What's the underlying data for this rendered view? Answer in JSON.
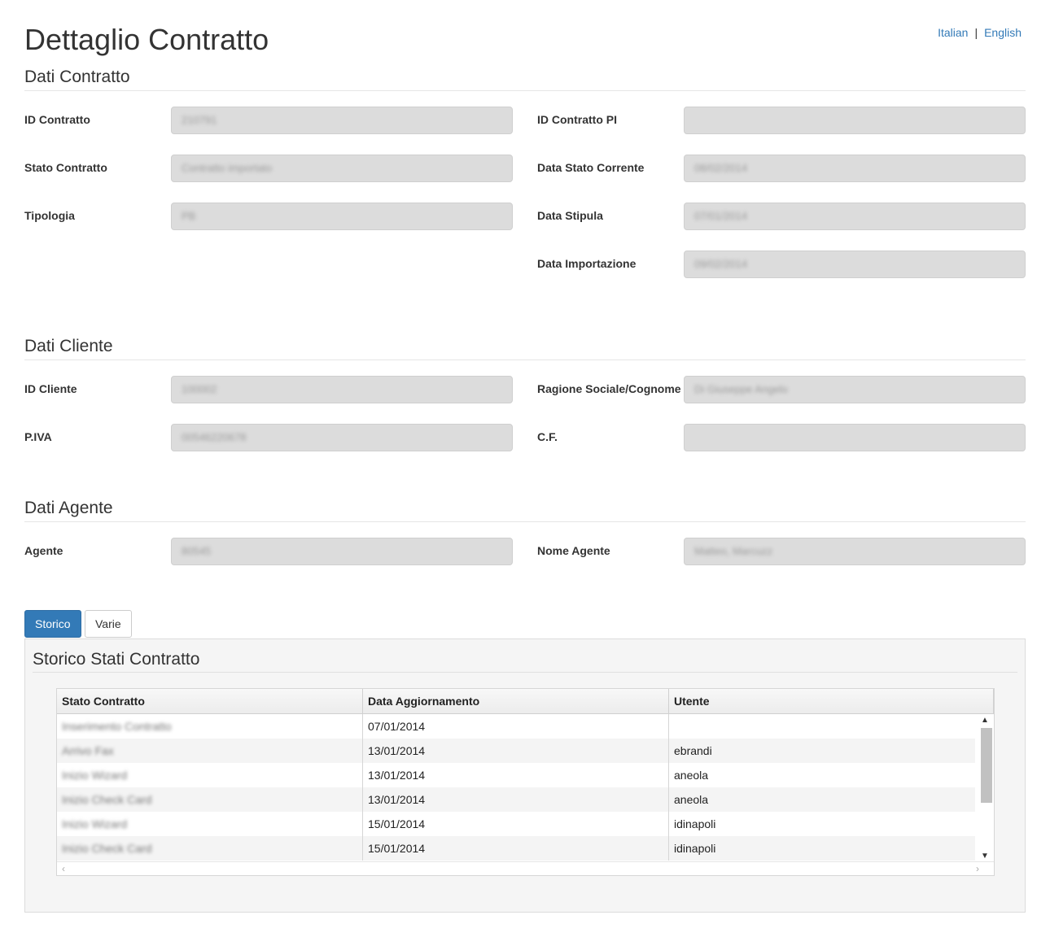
{
  "lang": {
    "italian": "Italian",
    "sep": "|",
    "english": "English"
  },
  "page_title": "Dettaglio Contratto",
  "sections": {
    "contratto": "Dati Contratto",
    "cliente": "Dati Cliente",
    "agente": "Dati Agente"
  },
  "contratto": {
    "id_contratto": {
      "label": "ID Contratto",
      "value": "210791"
    },
    "id_contratto_pi": {
      "label": "ID Contratto PI",
      "value": ""
    },
    "stato_contratto": {
      "label": "Stato Contratto",
      "value": "Contratto importato"
    },
    "data_stato_corrente": {
      "label": "Data Stato Corrente",
      "value": "08/02/2014"
    },
    "tipologia": {
      "label": "Tipologia",
      "value": "PB"
    },
    "data_stipula": {
      "label": "Data Stipula",
      "value": "07/01/2014"
    },
    "data_importazione": {
      "label": "Data Importazione",
      "value": "09/02/2014"
    }
  },
  "cliente": {
    "id_cliente": {
      "label": "ID Cliente",
      "value": "100002"
    },
    "ragione_sociale": {
      "label": "Ragione Sociale/Cognome",
      "value": "Di Giuseppe Angelo"
    },
    "piva": {
      "label": "P.IVA",
      "value": "00546220678"
    },
    "cf": {
      "label": "C.F.",
      "value": ""
    }
  },
  "agente": {
    "agente": {
      "label": "Agente",
      "value": "80545"
    },
    "nome_agente": {
      "label": "Nome Agente",
      "value": "Matteo, Marcuzz"
    }
  },
  "tabs": [
    {
      "label": "Storico",
      "active": true
    },
    {
      "label": "Varie",
      "active": false
    }
  ],
  "storico": {
    "title": "Storico Stati Contratto",
    "columns": [
      "Stato Contratto",
      "Data Aggiornamento",
      "Utente"
    ],
    "rows": [
      [
        "Inserimento Contratto",
        "07/01/2014",
        ""
      ],
      [
        "Arrivo Fax",
        "13/01/2014",
        "ebrandi"
      ],
      [
        "Inizio Wizard",
        "13/01/2014",
        "aneola"
      ],
      [
        "Inizio Check Card",
        "13/01/2014",
        "aneola"
      ],
      [
        "Inizio Wizard",
        "15/01/2014",
        "idinapoli"
      ],
      [
        "Inizio Check Card",
        "15/01/2014",
        "idinapoli"
      ]
    ]
  },
  "icons": {
    "scroll_up": "▲",
    "scroll_down": "▼",
    "scroll_left": "‹",
    "scroll_right": "›"
  },
  "colors": {
    "primary": "#337ab7",
    "field_bg": "#dcdcdc",
    "panel_bg": "#f5f5f5"
  }
}
